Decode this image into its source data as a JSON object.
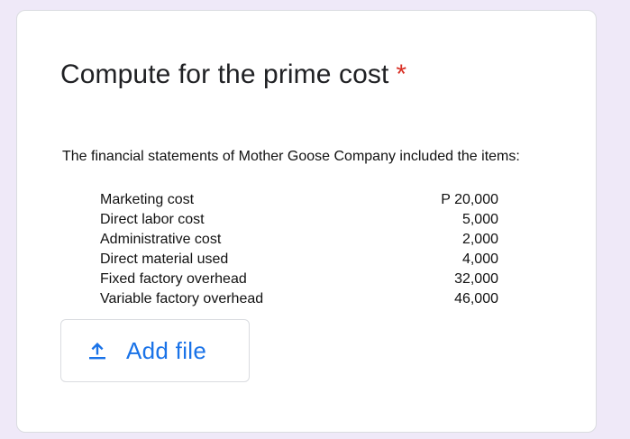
{
  "question": {
    "title": "Compute for the prime cost",
    "required_marker": "*",
    "intro": "The financial statements of Mother Goose Company included the items:",
    "items": [
      {
        "label": "Marketing cost",
        "amount": "P 20,000"
      },
      {
        "label": "Direct labor cost",
        "amount": "5,000"
      },
      {
        "label": "Administrative cost",
        "amount": "2,000"
      },
      {
        "label": "Direct material used",
        "amount": "4,000"
      },
      {
        "label": "Fixed factory overhead",
        "amount": "32,000"
      },
      {
        "label": "Variable factory overhead",
        "amount": "46,000"
      }
    ]
  },
  "upload": {
    "icon": "upload-icon",
    "label": "Add file"
  },
  "colors": {
    "background": "#efe9f8",
    "required": "#d93025",
    "accent": "#1a73e8"
  }
}
